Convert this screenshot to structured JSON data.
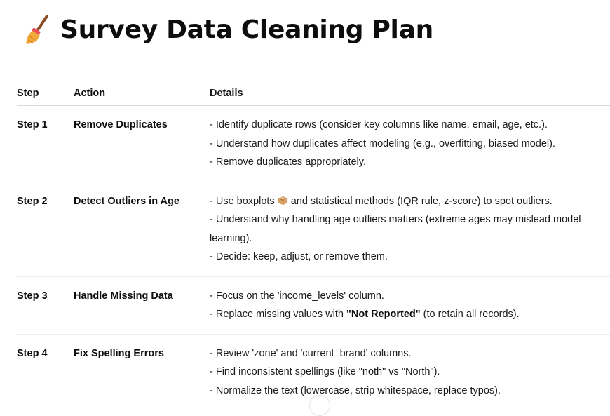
{
  "title": "Survey Data Cleaning Plan",
  "title_icon": "broom-icon",
  "table": {
    "headers": [
      "Step",
      "Action",
      "Details"
    ],
    "rows": [
      {
        "step": "Step 1",
        "action": "Remove Duplicates",
        "details": [
          "- Identify duplicate rows (consider key columns like name, email, age, etc.).",
          "- Understand how duplicates affect modeling (e.g., overfitting, biased model).",
          "- Remove duplicates appropriately."
        ]
      },
      {
        "step": "Step 2",
        "action": "Detect Outliers in Age",
        "details_parts": {
          "l1_before": "- Use boxplots",
          "l1_icon": "package-icon",
          "l1_after": "and statistical methods (IQR rule, z-score) to spot outliers.",
          "l2": "- Understand why handling age outliers matters (extreme ages may mislead model learning).",
          "l3": "- Decide: keep, adjust, or remove them."
        }
      },
      {
        "step": "Step 3",
        "action": "Handle Missing Data",
        "details_parts": {
          "l1": "- Focus on the 'income_levels' column.",
          "l2_before": "- Replace missing values with",
          "l2_bold": "\"Not Reported\"",
          "l2_after": "(to retain all records)."
        }
      },
      {
        "step": "Step 4",
        "action": "Fix Spelling Errors",
        "details": [
          "- Review 'zone' and 'current_brand' columns.",
          "- Find inconsistent spellings (like \"noth\" vs \"North\").",
          "- Normalize the text (lowercase, strip whitespace, replace typos)."
        ]
      }
    ]
  }
}
